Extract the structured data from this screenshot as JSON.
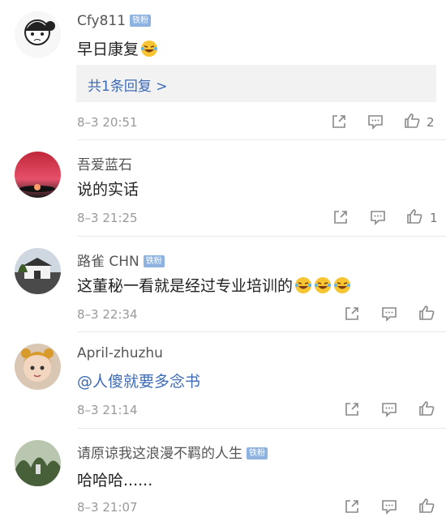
{
  "comments": [
    {
      "user": "Cfy811",
      "badge": "铁粉",
      "text": "早日康复",
      "reply": "共1条回复 >",
      "time": "8–3 20:51",
      "likes": "2"
    },
    {
      "user": "吾爱蓝石",
      "text": "说的实话",
      "time": "8–3 21:25",
      "likes": "1"
    },
    {
      "user": "路雀 CHN",
      "badge": "铁粉",
      "text": "这董秘一看就是经过专业培训的",
      "time": "8–3 22:34"
    },
    {
      "user": "April-zhuzhu",
      "text": "@人傻就要多念书",
      "time": "8–3 21:14"
    },
    {
      "user": "请原谅我这浪漫不羁的人生",
      "badge": "铁粉",
      "text": "哈哈哈......",
      "time": "8–3 21:07"
    }
  ],
  "colors": {
    "link": "#3d6bb5",
    "badge": "#8fb3e0",
    "meta": "#999999"
  }
}
